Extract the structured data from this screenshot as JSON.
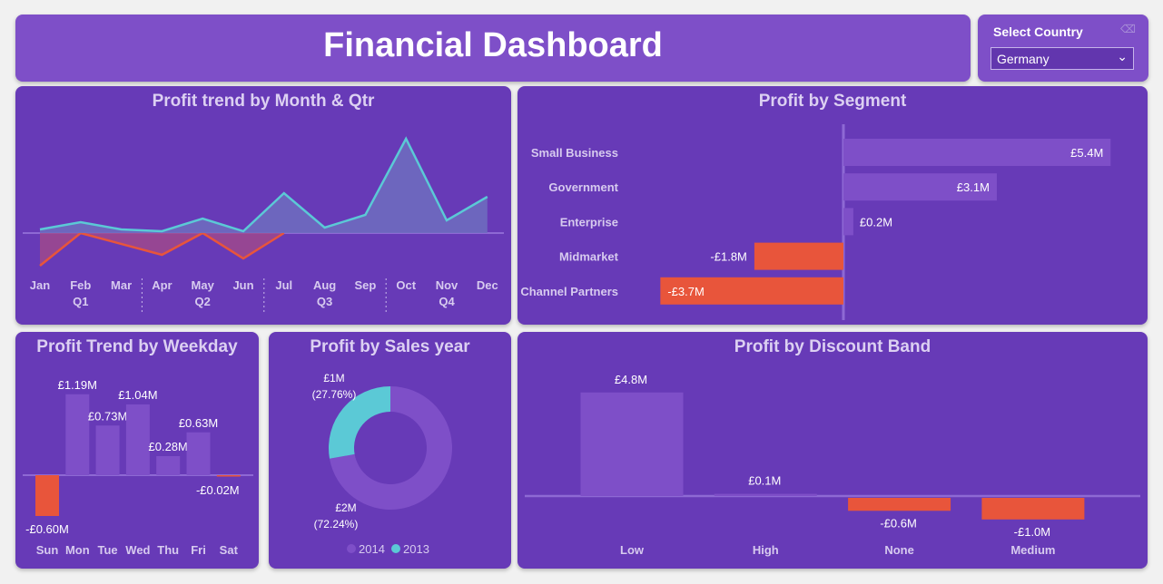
{
  "header": {
    "title": "Financial Dashboard"
  },
  "slicer": {
    "label": "Select Country",
    "value": "Germany",
    "icon": "chevron-down-icon",
    "eraser_icon": "eraser-icon"
  },
  "colors": {
    "positive": "#7e4fc8",
    "negative": "#e8553b",
    "line_2014": "#5bc9d6",
    "line_2013": "#e8553b",
    "donut_2014": "#7e4fc8",
    "donut_2013": "#5bc9d6"
  },
  "chart_data": [
    {
      "id": "month",
      "type": "area",
      "title": "Profit trend by Month & Qtr",
      "categories": [
        "Jan",
        "Feb",
        "Mar",
        "Apr",
        "May",
        "Jun",
        "Jul",
        "Aug",
        "Sep",
        "Oct",
        "Nov",
        "Dec"
      ],
      "quarters": [
        "Q1",
        "Q2",
        "Q3",
        "Q4"
      ],
      "series": [
        {
          "values": [
            0.1,
            0.3,
            0.1,
            0.05,
            0.4,
            0.05,
            1.1,
            0.15,
            0.5,
            2.6,
            0.35,
            1.0
          ]
        },
        {
          "values": [
            -0.9,
            0,
            null,
            -0.6,
            0,
            -0.7,
            0,
            null,
            null,
            null,
            null,
            null
          ]
        }
      ],
      "ylim": [
        -1.0,
        2.6
      ]
    },
    {
      "id": "segment",
      "type": "bar",
      "title": "Profit by Segment",
      "categories": [
        "Small Business",
        "Government",
        "Enterprise",
        "Midmarket",
        "Channel Partners"
      ],
      "values": [
        5.4,
        3.1,
        0.2,
        -1.8,
        -3.7
      ],
      "labels": [
        "£5.4M",
        "£3.1M",
        "£0.2M",
        "-£1.8M",
        "-£3.7M"
      ]
    },
    {
      "id": "weekday",
      "type": "bar",
      "title": "Profit Trend by Weekday",
      "categories": [
        "Sun",
        "Mon",
        "Tue",
        "Wed",
        "Thu",
        "Fri",
        "Sat"
      ],
      "values": [
        -0.6,
        1.19,
        0.73,
        1.04,
        0.28,
        0.63,
        -0.02
      ],
      "labels": [
        "-£0.60M",
        "£1.19M",
        "£0.73M",
        "£1.04M",
        "£0.28M",
        "£0.63M",
        "-£0.02M"
      ]
    },
    {
      "id": "year",
      "type": "pie",
      "title": "Profit by Sales year",
      "categories": [
        "2014",
        "2013"
      ],
      "values": [
        72.24,
        27.76
      ],
      "labels": [
        "£2M",
        "£1M"
      ],
      "percent_labels": [
        "(72.24%)",
        "(27.76%)"
      ]
    },
    {
      "id": "discount",
      "type": "bar",
      "title": "Profit by Discount Band",
      "categories": [
        "Low",
        "High",
        "None",
        "Medium"
      ],
      "values": [
        4.8,
        0.1,
        -0.6,
        -1.0
      ],
      "labels": [
        "£4.8M",
        "£0.1M",
        "-£0.6M",
        "-£1.0M"
      ]
    }
  ]
}
